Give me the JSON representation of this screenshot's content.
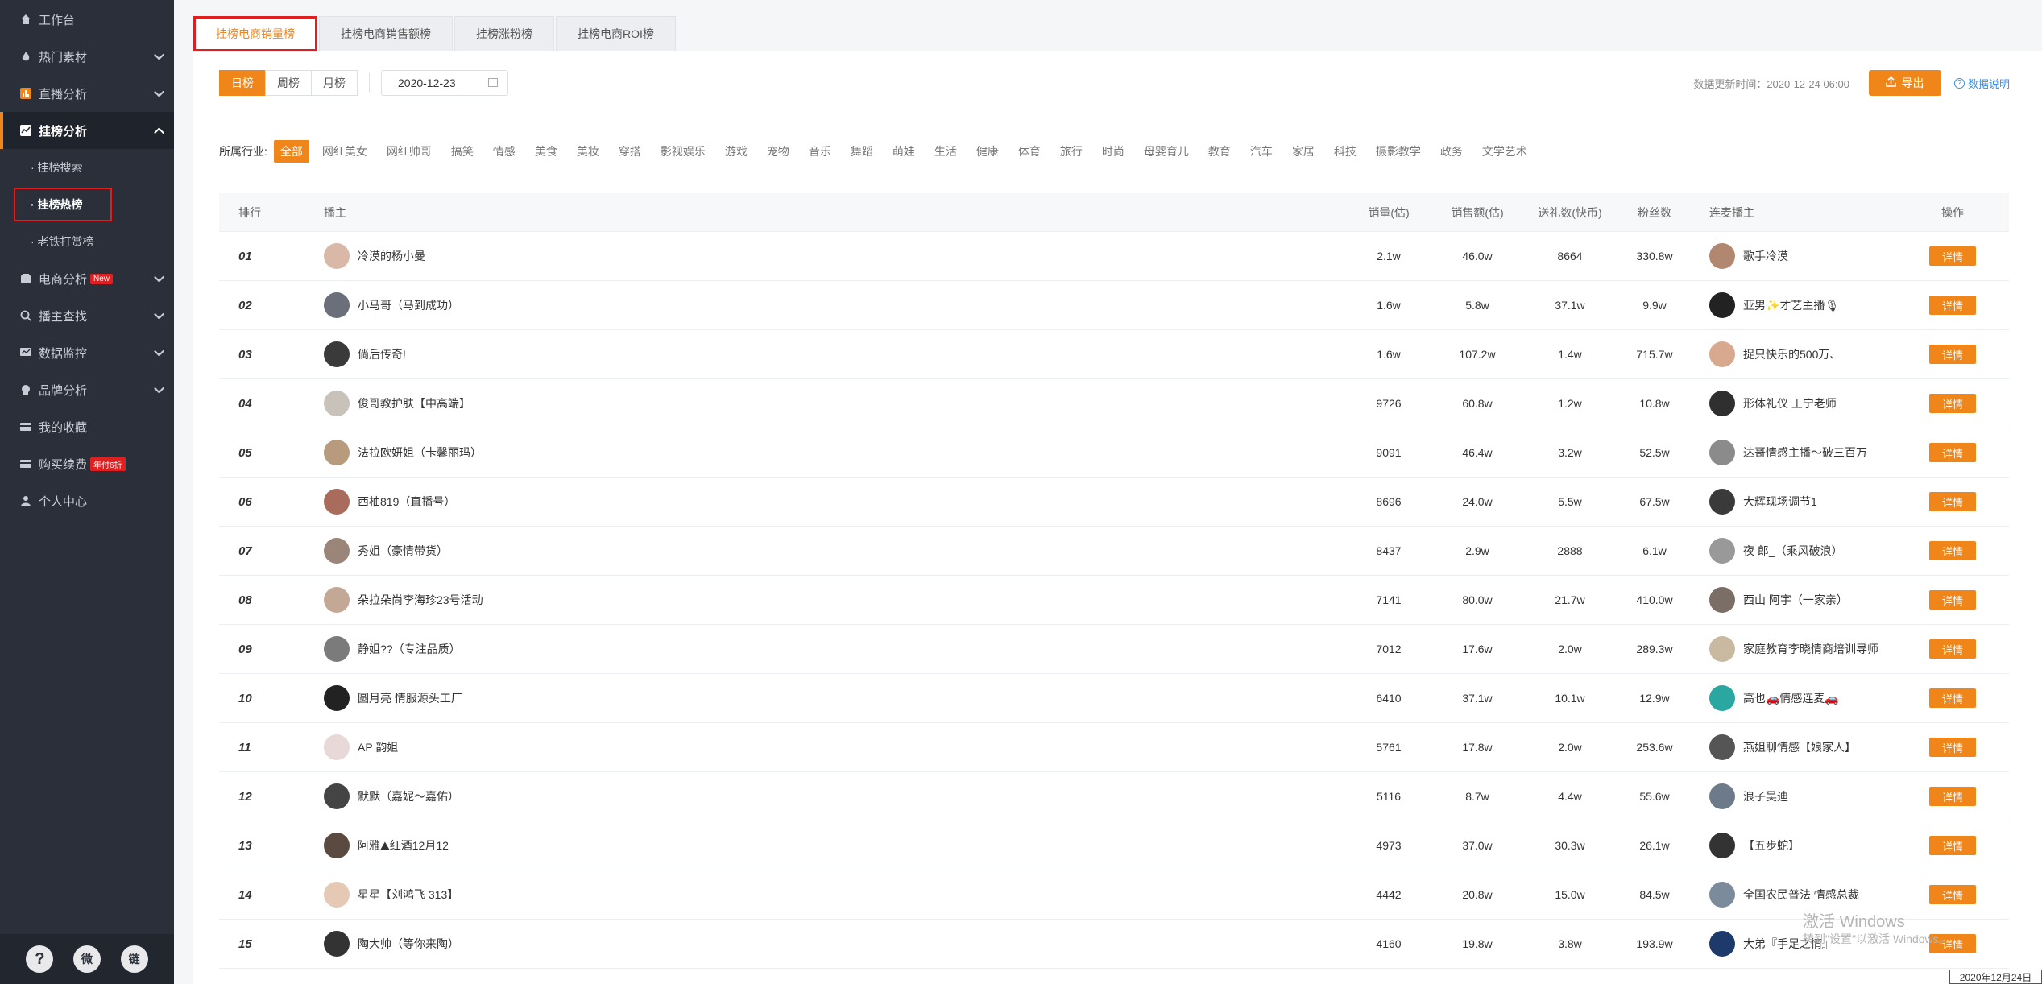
{
  "sidebar": {
    "items": [
      {
        "label": "工作台",
        "icon": "home-icon"
      },
      {
        "label": "热门素材",
        "icon": "fire-icon"
      },
      {
        "label": "直播分析",
        "icon": "chart-icon"
      },
      {
        "label": "挂榜分析",
        "icon": "trend-icon"
      },
      {
        "label": "电商分析",
        "icon": "store-icon",
        "badge": "New"
      },
      {
        "label": "播主查找",
        "icon": "search-icon"
      },
      {
        "label": "数据监控",
        "icon": "monitor-icon"
      },
      {
        "label": "品牌分析",
        "icon": "brand-icon"
      },
      {
        "label": "我的收藏",
        "icon": "collect-icon"
      },
      {
        "label": "购买续费",
        "icon": "card-icon",
        "badge": "年付6折"
      },
      {
        "label": "个人中心",
        "icon": "user-icon"
      }
    ],
    "sub_items": [
      "· 挂榜搜索",
      "· 挂榜热榜",
      "· 老铁打赏榜"
    ],
    "footer": [
      "?",
      "微",
      "链"
    ]
  },
  "tabs": [
    "挂榜电商销量榜",
    "挂榜电商销售额榜",
    "挂榜涨粉榜",
    "挂榜电商ROI榜"
  ],
  "toolbar": {
    "periods": [
      "日榜",
      "周榜",
      "月榜"
    ],
    "date": "2020-12-23",
    "update_time": "数据更新时间：2020-12-24 06:00",
    "export_label": "导出",
    "help_label": "数据说明"
  },
  "industry": {
    "label": "所属行业:",
    "options": [
      "全部",
      "网红美女",
      "网红帅哥",
      "搞笑",
      "情感",
      "美食",
      "美妆",
      "穿搭",
      "影视娱乐",
      "游戏",
      "宠物",
      "音乐",
      "舞蹈",
      "萌娃",
      "生活",
      "健康",
      "体育",
      "旅行",
      "时尚",
      "母婴育儿",
      "教育",
      "汽车",
      "家居",
      "科技",
      "摄影教学",
      "政务",
      "文学艺术"
    ]
  },
  "table": {
    "headers": [
      "排行",
      "播主",
      "销量(估)",
      "销售额(估)",
      "送礼数(快币)",
      "粉丝数",
      "连麦播主",
      "操作"
    ],
    "rows": [
      {
        "rank": "01",
        "anchor": "冷漠的杨小曼",
        "sales": "2.1w",
        "revenue": "46.0w",
        "gifts": "8664",
        "fans": "330.8w",
        "linked": "歌手冷漠",
        "action": "详情"
      },
      {
        "rank": "02",
        "anchor": "小马哥（马到成功）",
        "sales": "1.6w",
        "revenue": "5.8w",
        "gifts": "37.1w",
        "fans": "9.9w",
        "linked": "亚男✨才艺主播🎙",
        "action": "详情"
      },
      {
        "rank": "03",
        "anchor": "倘后传奇!",
        "sales": "1.6w",
        "revenue": "107.2w",
        "gifts": "1.4w",
        "fans": "715.7w",
        "linked": "捉只快乐的500万、",
        "action": "详情"
      },
      {
        "rank": "04",
        "anchor": "俊哥教护肤【中高端】",
        "sales": "9726",
        "revenue": "60.8w",
        "gifts": "1.2w",
        "fans": "10.8w",
        "linked": "形体礼仪 王宁老师",
        "action": "详情"
      },
      {
        "rank": "05",
        "anchor": "法拉欧妍姐（卡馨丽玛）",
        "sales": "9091",
        "revenue": "46.4w",
        "gifts": "3.2w",
        "fans": "52.5w",
        "linked": "达哥情感主播～破三百万",
        "action": "详情"
      },
      {
        "rank": "06",
        "anchor": "西柚819（直播号）",
        "sales": "8696",
        "revenue": "24.0w",
        "gifts": "5.5w",
        "fans": "67.5w",
        "linked": "大辉现场调节1",
        "action": "详情"
      },
      {
        "rank": "07",
        "anchor": "秀姐（豪情带货）",
        "sales": "8437",
        "revenue": "2.9w",
        "gifts": "2888",
        "fans": "6.1w",
        "linked": "夜 郎_（乘风破浪）",
        "action": "详情"
      },
      {
        "rank": "08",
        "anchor": "朵拉朵尚李海珍23号活动",
        "sales": "7141",
        "revenue": "80.0w",
        "gifts": "21.7w",
        "fans": "410.0w",
        "linked": "西山 阿宇（一家亲）",
        "action": "详情"
      },
      {
        "rank": "09",
        "anchor": "静姐??（专注品质）",
        "sales": "7012",
        "revenue": "17.6w",
        "gifts": "2.0w",
        "fans": "289.3w",
        "linked": "家庭教育李晓情商培训导师",
        "action": "详情"
      },
      {
        "rank": "10",
        "anchor": "圆月亮 情服源头工厂",
        "sales": "6410",
        "revenue": "37.1w",
        "gifts": "10.1w",
        "fans": "12.9w",
        "linked": "高也🚗情感连麦🚗",
        "action": "详情"
      },
      {
        "rank": "11",
        "anchor": "AP 韵姐",
        "sales": "5761",
        "revenue": "17.8w",
        "gifts": "2.0w",
        "fans": "253.6w",
        "linked": "燕姐聊情感【娘家人】",
        "action": "详情"
      },
      {
        "rank": "12",
        "anchor": "默默（嘉妮～嘉佑）",
        "sales": "5116",
        "revenue": "8.7w",
        "gifts": "4.4w",
        "fans": "55.6w",
        "linked": "浪子吴迪",
        "action": "详情"
      },
      {
        "rank": "13",
        "anchor": "阿雅⛰红酒12月12",
        "sales": "4973",
        "revenue": "37.0w",
        "gifts": "30.3w",
        "fans": "26.1w",
        "linked": "【五步蛇】",
        "action": "详情"
      },
      {
        "rank": "14",
        "anchor": "星星【刘鸿飞 313】",
        "sales": "4442",
        "revenue": "20.8w",
        "gifts": "15.0w",
        "fans": "84.5w",
        "linked": "全国农民普法 情感总裁",
        "action": "详情"
      },
      {
        "rank": "15",
        "anchor": "陶大帅（等你来陶）",
        "sales": "4160",
        "revenue": "19.8w",
        "gifts": "3.8w",
        "fans": "193.9w",
        "linked": "大弟『手足之情』",
        "action": "详情"
      }
    ]
  },
  "overlay": {
    "watermark_title": "激活 Windows",
    "watermark_sub": "转到\"设置\"以激活 Windows。",
    "clock": "2020年12月24日"
  },
  "colors": {
    "accent": "#f08519",
    "sidebar": "#2a2f3a",
    "highlight": "#e02020",
    "link": "#3a8ee6"
  }
}
